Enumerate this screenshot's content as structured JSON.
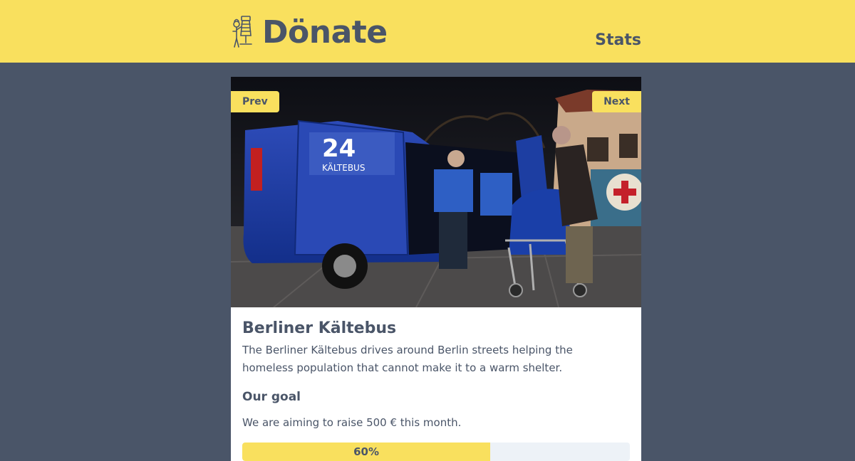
{
  "header": {
    "logo_text": "Dönate",
    "stats_label": "Stats",
    "colors": {
      "bar": "#f9e05e",
      "text": "#4a5568"
    }
  },
  "project": {
    "prev_label": "Prev",
    "next_label": "Next",
    "title": "Berliner Kältebus",
    "description": "The Berliner Kältebus drives around Berlin streets helping the homeless population that cannot make it to a warm shelter.",
    "goal_heading": "Our goal",
    "goal_text": "We are aiming to raise 500 € this month.",
    "progress_label": "60%",
    "progress_fraction": 0.64
  }
}
